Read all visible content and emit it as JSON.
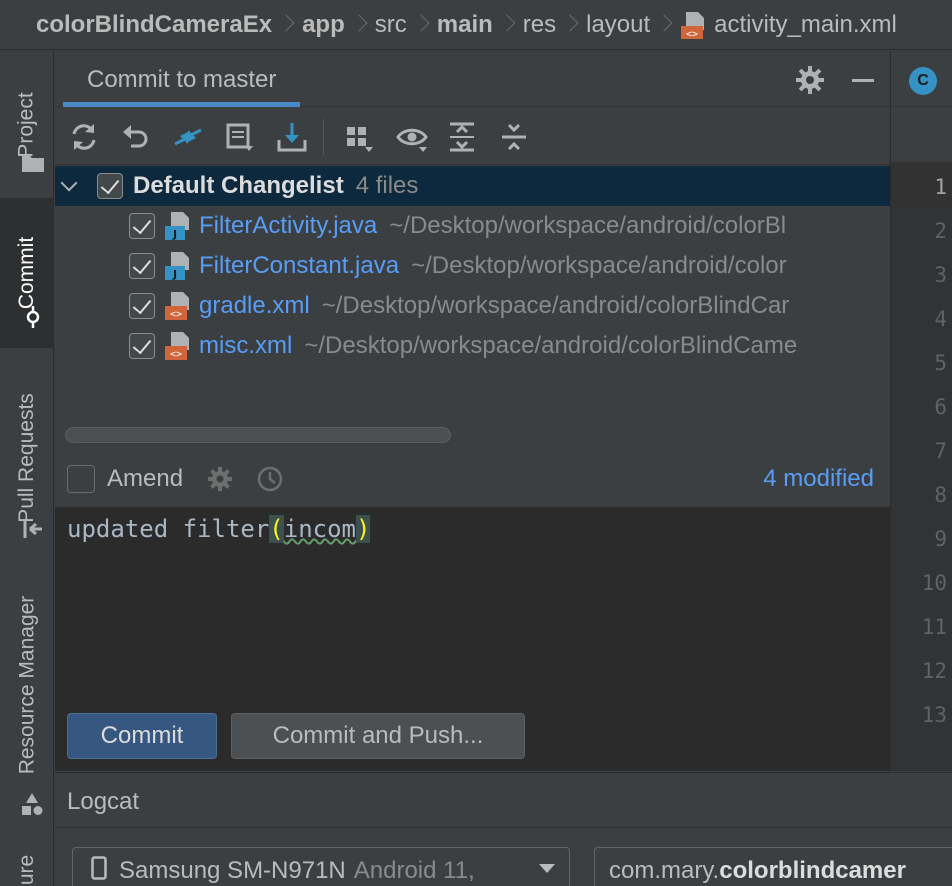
{
  "breadcrumb": {
    "project": "colorBlindCameraEx",
    "module": "app",
    "src": "src",
    "main": "main",
    "res": "res",
    "layout": "layout",
    "file": "activity_main.xml"
  },
  "left_tabs": {
    "project": "Project",
    "commit": "Commit",
    "pull_requests": "Pull Requests",
    "resource_manager": "Resource Manager",
    "bottom_partial": "ure"
  },
  "commit_panel": {
    "title": "Commit to master",
    "changelist": {
      "name": "Default Changelist",
      "count": "4 files",
      "checked": true
    },
    "files": [
      {
        "name": "FilterActivity.java",
        "path": "~/Desktop/workspace/android/colorBl",
        "type": "java",
        "checked": true
      },
      {
        "name": "FilterConstant.java",
        "path": "~/Desktop/workspace/android/color",
        "type": "java",
        "checked": true
      },
      {
        "name": "gradle.xml",
        "path": "~/Desktop/workspace/android/colorBlindCar",
        "type": "xml",
        "checked": true
      },
      {
        "name": "misc.xml",
        "path": "~/Desktop/workspace/android/colorBlindCame",
        "type": "xml",
        "checked": true
      }
    ],
    "amend_label": "Amend",
    "modified_count": "4 modified",
    "message": {
      "prefix": "updated filter",
      "open_paren": "(",
      "word": "incom",
      "close_paren": ")"
    },
    "commit_label": "Commit",
    "commit_push_label": "Commit and Push..."
  },
  "editor": {
    "tab_letter": "C",
    "line_numbers": [
      "1",
      "2",
      "3",
      "4",
      "5",
      "6",
      "7",
      "8",
      "9",
      "10",
      "11",
      "12",
      "13"
    ]
  },
  "logcat": {
    "title": "Logcat",
    "device_name": "Samsung SM-N971N",
    "device_os": "Android 11,",
    "process_prefix": "com.mary.",
    "process_bold": "colorblindcamer"
  },
  "colors": {
    "accent": "#4a88c7",
    "link": "#589df6",
    "selection": "#0d293e",
    "commit_button": "#365880"
  }
}
